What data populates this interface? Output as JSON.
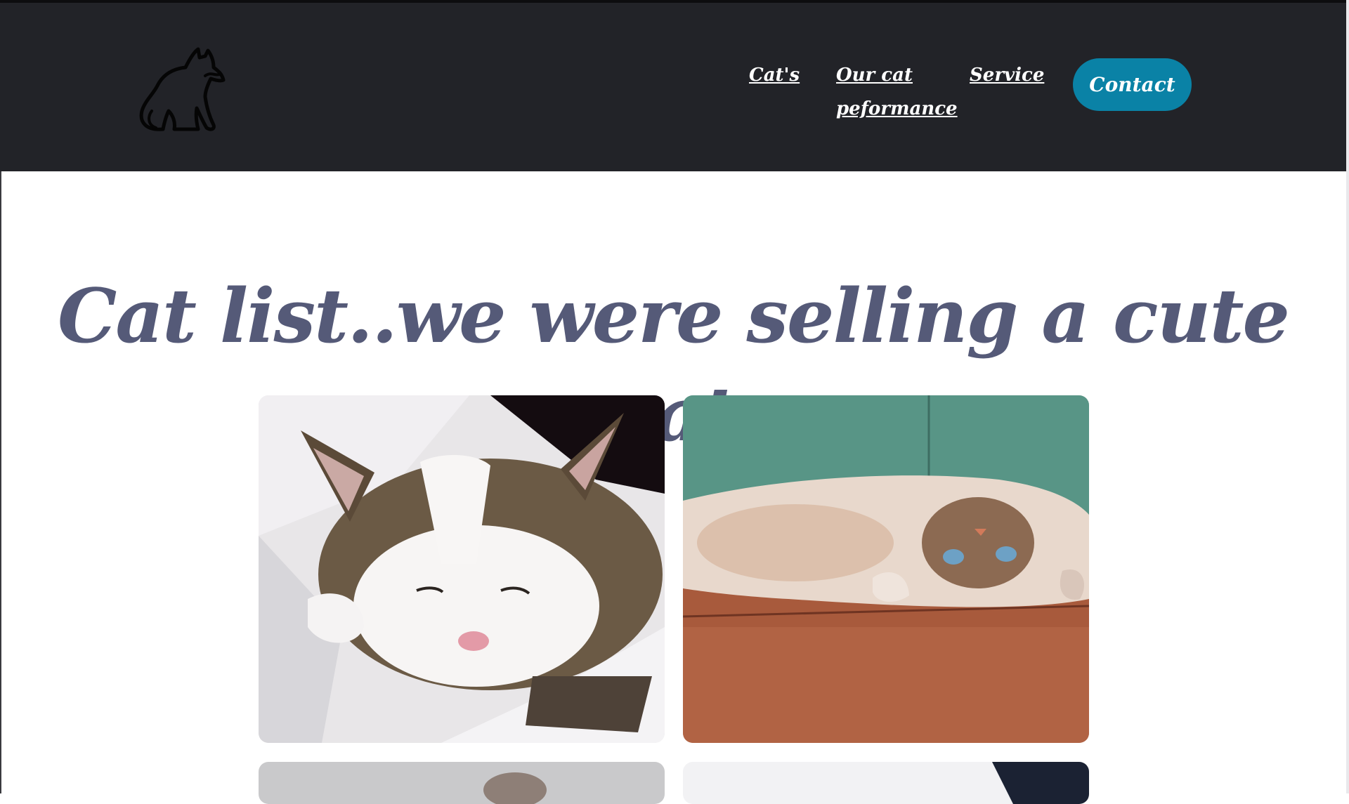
{
  "nav": {
    "logo_icon": "cat-silhouette-icon",
    "links": [
      {
        "label": "Cat's"
      },
      {
        "label": "Our cat peformance"
      },
      {
        "label": "Service"
      }
    ],
    "contact_label": "Contact"
  },
  "main": {
    "title": "Cat list..we were selling a cute cat",
    "cards": [
      {
        "icon": "sleeping-tabby-cat-photo"
      },
      {
        "icon": "cat-lying-on-wooden-floor-photo"
      },
      {
        "icon": "grey-cat-photo"
      },
      {
        "icon": "cat-on-white-bedding-photo"
      }
    ]
  },
  "colors": {
    "header_bg": "#222328",
    "accent": "#0a82a6",
    "title": "#555a78"
  }
}
